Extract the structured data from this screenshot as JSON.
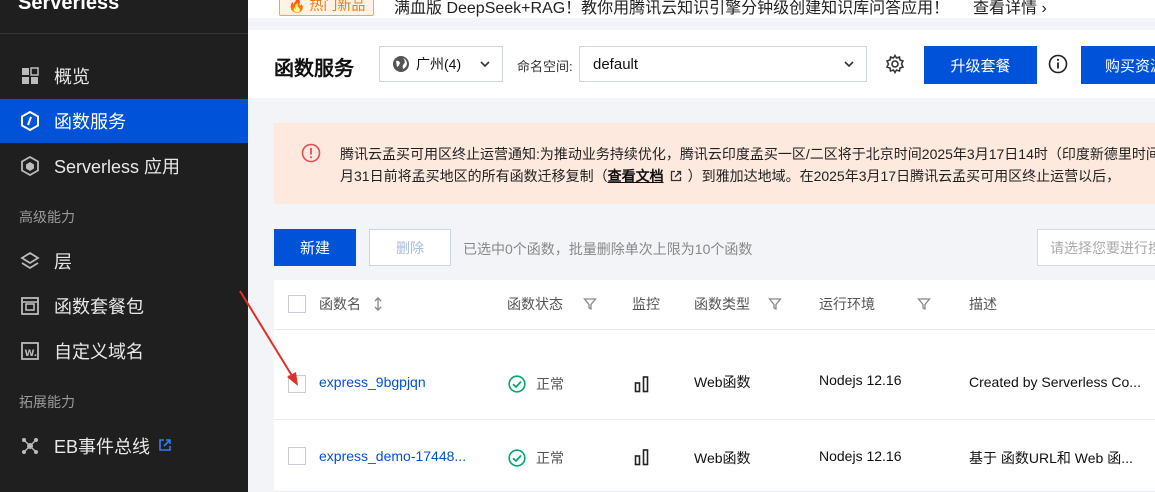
{
  "sidebar": {
    "brand": "Serverless",
    "items": [
      {
        "label": "概览",
        "icon": "dashboard-icon"
      },
      {
        "label": "函数服务",
        "icon": "function-icon",
        "active": true
      },
      {
        "label": "Serverless 应用",
        "icon": "app-icon"
      }
    ],
    "sections": [
      {
        "label": "高级能力"
      },
      {
        "label": "拓展能力"
      }
    ],
    "advanced_items": [
      {
        "label": "层",
        "icon": "layers-icon"
      },
      {
        "label": "函数套餐包",
        "icon": "package-icon"
      },
      {
        "label": "自定义域名",
        "icon": "domain-icon"
      }
    ],
    "ext_items": [
      {
        "label": "EB事件总线",
        "icon": "event-bus-icon"
      }
    ]
  },
  "announcement": {
    "badge": "🔥 热门新品",
    "text": "满血版 DeepSeek+RAG！教你用腾讯云知识引擎分钟级创建知识库问答应用！",
    "link": "查看详情 ›"
  },
  "header": {
    "title": "函数服务",
    "region": "广州(4)",
    "namespace_label": "命名空间:",
    "namespace": "default",
    "upgrade_label": "升级套餐",
    "buy_label": "购买资源"
  },
  "notice": {
    "line1": "腾讯云孟买可用区终止运营通知:为推动业务持续优化，腾讯云印度孟买一区/二区将于北京时间2025年3月17日14时（印度新德里时间",
    "line2_a": "月31日前将孟买地区的所有函数迁移复制（",
    "doc_link": "查看文档",
    "line2_b": "）到雅加达地域。在2025年3月17日腾讯云孟买可用区终止运营以后，"
  },
  "toolbar": {
    "new_label": "新建",
    "delete_label": "删除",
    "hint": "已选中0个函数，批量删除单次上限为10个函数",
    "search_placeholder": "请选择您要进行搜索的"
  },
  "table": {
    "columns": [
      "函数名",
      "函数状态",
      "监控",
      "函数类型",
      "运行环境",
      "描述"
    ],
    "rows": [
      {
        "name": "express_9bgpjqn",
        "status": "正常",
        "type": "Web函数",
        "runtime": "Nodejs 12.16",
        "description": "Created by Serverless Co..."
      },
      {
        "name": "express_demo-17448...",
        "status": "正常",
        "type": "Web函数",
        "runtime": "Nodejs 12.16",
        "description": "基于 函数URL和 Web 函..."
      }
    ]
  },
  "colors": {
    "primary": "#0052d9",
    "sidebar_bg": "#1f1f1f",
    "notice_bg": "#fde9de",
    "ok_green": "#00a870",
    "annotation_red": "#e0302a"
  }
}
